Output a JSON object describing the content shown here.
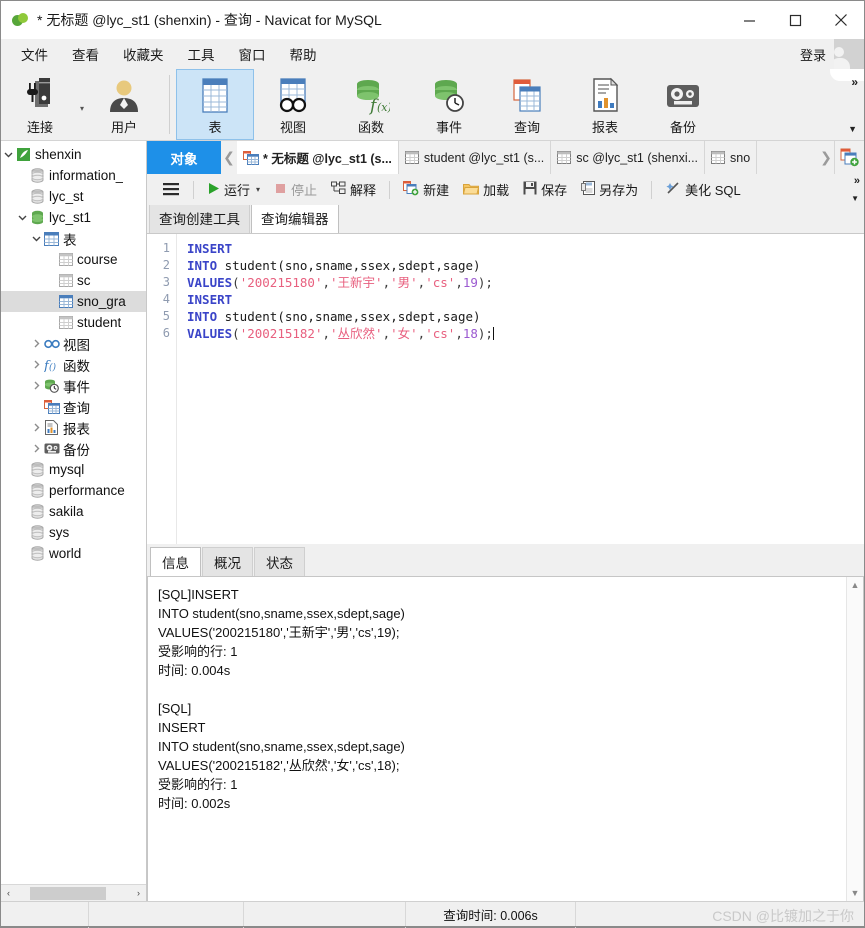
{
  "window": {
    "title": "* 无标题 @lyc_st1 (shenxin) - 查询 - Navicat for MySQL",
    "logo_icon": "navicat-leaf-icon",
    "minimize_icon": "minimize-icon",
    "maximize_icon": "maximize-icon",
    "close_icon": "close-icon"
  },
  "menubar": {
    "items": [
      {
        "label": "文件"
      },
      {
        "label": "查看"
      },
      {
        "label": "收藏夹"
      },
      {
        "label": "工具"
      },
      {
        "label": "窗口"
      },
      {
        "label": "帮助"
      }
    ],
    "login_label": "登录",
    "avatar_icon": "user-avatar-icon"
  },
  "ribbon": {
    "buttons": [
      {
        "label": "连接",
        "icon": "connection-icon",
        "active": false
      },
      {
        "label": "用户",
        "icon": "user-icon",
        "active": false
      },
      {
        "label": "表",
        "icon": "table-icon",
        "active": true
      },
      {
        "label": "视图",
        "icon": "view-glasses-icon",
        "active": false
      },
      {
        "label": "函数",
        "icon": "function-fx-icon",
        "active": false
      },
      {
        "label": "事件",
        "icon": "event-clock-icon",
        "active": false
      },
      {
        "label": "查询",
        "icon": "query-icon",
        "active": false
      },
      {
        "label": "报表",
        "icon": "report-icon",
        "active": false
      },
      {
        "label": "备份",
        "icon": "backup-tape-icon",
        "active": false
      }
    ],
    "expand_icon": "chevron-double-right-icon",
    "more_icon": "chevron-down-icon"
  },
  "sidebar": {
    "nodes": [
      {
        "label": "shenxin",
        "indent": 0,
        "icon": "connection-leaf-icon",
        "expander": "down",
        "selected": false
      },
      {
        "label": "information_",
        "indent": 1,
        "icon": "database-gray-icon",
        "expander": "none",
        "selected": false
      },
      {
        "label": "lyc_st",
        "indent": 1,
        "icon": "database-gray-icon",
        "expander": "none",
        "selected": false
      },
      {
        "label": "lyc_st1",
        "indent": 1,
        "icon": "database-green-icon",
        "expander": "down",
        "selected": false
      },
      {
        "label": "表",
        "indent": 2,
        "icon": "table-folder-icon",
        "expander": "down",
        "selected": false
      },
      {
        "label": "course",
        "indent": 3,
        "icon": "table-gray-icon",
        "expander": "none",
        "selected": false
      },
      {
        "label": "sc",
        "indent": 3,
        "icon": "table-gray-icon",
        "expander": "none",
        "selected": false
      },
      {
        "label": "sno_gra",
        "indent": 3,
        "icon": "table-blue-icon",
        "expander": "none",
        "selected": true
      },
      {
        "label": "student",
        "indent": 3,
        "icon": "table-gray-icon",
        "expander": "none",
        "selected": false
      },
      {
        "label": "视图",
        "indent": 2,
        "icon": "view-glasses-icon",
        "expander": "right",
        "selected": false
      },
      {
        "label": "函数",
        "indent": 2,
        "icon": "function-fx-icon",
        "expander": "right",
        "selected": false
      },
      {
        "label": "事件",
        "indent": 2,
        "icon": "event-clock-icon",
        "expander": "right",
        "selected": false
      },
      {
        "label": "查询",
        "indent": 2,
        "icon": "query-icon",
        "expander": "none",
        "selected": false
      },
      {
        "label": "报表",
        "indent": 2,
        "icon": "report-icon",
        "expander": "right",
        "selected": false
      },
      {
        "label": "备份",
        "indent": 2,
        "icon": "backup-tape-icon",
        "expander": "right",
        "selected": false
      },
      {
        "label": "mysql",
        "indent": 1,
        "icon": "database-gray-icon",
        "expander": "none",
        "selected": false
      },
      {
        "label": "performance",
        "indent": 1,
        "icon": "database-gray-icon",
        "expander": "none",
        "selected": false
      },
      {
        "label": "sakila",
        "indent": 1,
        "icon": "database-gray-icon",
        "expander": "none",
        "selected": false
      },
      {
        "label": "sys",
        "indent": 1,
        "icon": "database-gray-icon",
        "expander": "none",
        "selected": false
      },
      {
        "label": "world",
        "indent": 1,
        "icon": "database-gray-icon",
        "expander": "none",
        "selected": false
      }
    ],
    "hscroll": {
      "left_arrow": "‹",
      "right_arrow": "›"
    }
  },
  "tabstrip": {
    "object_tab": "对象",
    "prev_icon": "chevron-left-icon",
    "next_icon": "chevron-right-icon",
    "new_tab_icon": "new-query-icon",
    "tabs": [
      {
        "label": "* 无标题 @lyc_st1 (s...",
        "icon": "query-icon",
        "active": true
      },
      {
        "label": "student @lyc_st1 (s...",
        "icon": "table-icon",
        "active": false
      },
      {
        "label": "sc @lyc_st1 (shenxi...",
        "icon": "table-icon",
        "active": false
      },
      {
        "label": "sno",
        "icon": "table-icon",
        "active": false
      }
    ]
  },
  "query_toolbar": {
    "menu_icon": "hamburger-menu-icon",
    "buttons": [
      {
        "label": "运行",
        "icon": "play-icon",
        "disabled": false,
        "has_caret": true
      },
      {
        "label": "停止",
        "icon": "stop-icon",
        "disabled": true,
        "has_caret": false
      },
      {
        "label": "解释",
        "icon": "explain-icon",
        "disabled": false,
        "has_caret": false
      },
      {
        "label": "新建",
        "icon": "new-icon",
        "disabled": false,
        "has_caret": false
      },
      {
        "label": "加载",
        "icon": "folder-icon",
        "disabled": false,
        "has_caret": false
      },
      {
        "label": "保存",
        "icon": "save-icon",
        "disabled": false,
        "has_caret": false
      },
      {
        "label": "另存为",
        "icon": "save-as-icon",
        "disabled": false,
        "has_caret": false
      },
      {
        "label": "美化 SQL",
        "icon": "beautify-icon",
        "disabled": false,
        "has_caret": false
      }
    ],
    "expand_icon": "chevron-double-right-icon",
    "more_icon": "chevron-down-icon"
  },
  "editor_tabs": [
    {
      "label": "查询创建工具",
      "active": false
    },
    {
      "label": "查询编辑器",
      "active": true
    }
  ],
  "sql_editor": {
    "line_numbers": [
      "1",
      "2",
      "3",
      "4",
      "5",
      "6"
    ],
    "lines": [
      [
        {
          "t": "INSERT",
          "c": "kw"
        }
      ],
      [
        {
          "t": "INTO",
          "c": "kw"
        },
        {
          "t": " student",
          "c": "idt"
        },
        {
          "t": "(sno,sname,ssex,sdept,sage)",
          "c": "idt"
        }
      ],
      [
        {
          "t": "VALUES",
          "c": "kw"
        },
        {
          "t": "(",
          "c": "pun"
        },
        {
          "t": "'200215180'",
          "c": "str"
        },
        {
          "t": ",",
          "c": "pun"
        },
        {
          "t": "'王新宇'",
          "c": "str"
        },
        {
          "t": ",",
          "c": "pun"
        },
        {
          "t": "'男'",
          "c": "str"
        },
        {
          "t": ",",
          "c": "pun"
        },
        {
          "t": "'cs'",
          "c": "str"
        },
        {
          "t": ",",
          "c": "pun"
        },
        {
          "t": "19",
          "c": "num"
        },
        {
          "t": ");",
          "c": "pun"
        }
      ],
      [
        {
          "t": "INSERT",
          "c": "kw"
        }
      ],
      [
        {
          "t": "INTO",
          "c": "kw"
        },
        {
          "t": " student",
          "c": "idt"
        },
        {
          "t": "(sno,sname,ssex,sdept,sage)",
          "c": "idt"
        }
      ],
      [
        {
          "t": "VALUES",
          "c": "kw"
        },
        {
          "t": "(",
          "c": "pun"
        },
        {
          "t": "'200215182'",
          "c": "str"
        },
        {
          "t": ",",
          "c": "pun"
        },
        {
          "t": "'丛欣然'",
          "c": "str"
        },
        {
          "t": ",",
          "c": "pun"
        },
        {
          "t": "'女'",
          "c": "str"
        },
        {
          "t": ",",
          "c": "pun"
        },
        {
          "t": "'cs'",
          "c": "str"
        },
        {
          "t": ",",
          "c": "pun"
        },
        {
          "t": "18",
          "c": "num"
        },
        {
          "t": ");",
          "c": "pun"
        }
      ]
    ]
  },
  "results": {
    "tabs": [
      {
        "label": "信息",
        "active": true
      },
      {
        "label": "概况",
        "active": false
      },
      {
        "label": "状态",
        "active": false
      }
    ],
    "log": "[SQL]INSERT\nINTO student(sno,sname,ssex,sdept,sage)\nVALUES('200215180','王新宇','男','cs',19);\n受影响的行: 1\n时间: 0.004s\n\n[SQL]\nINSERT\nINTO student(sno,sname,ssex,sdept,sage)\nVALUES('200215182','丛欣然','女','cs',18);\n受影响的行: 1\n时间: 0.002s",
    "scroll_up_icon": "chevron-up-icon",
    "scroll_down_icon": "chevron-down-icon"
  },
  "statusbar": {
    "query_time": "查询时间: 0.006s",
    "watermark": "CSDN @比镀加之于你"
  }
}
